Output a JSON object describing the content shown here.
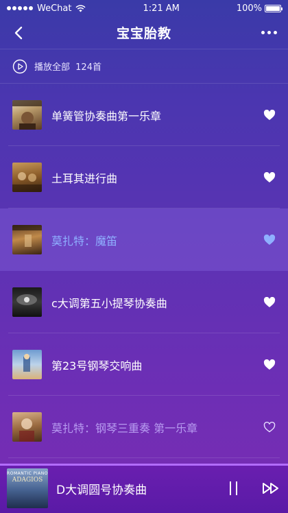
{
  "status_bar": {
    "carrier": "WeChat",
    "time": "1:21 AM",
    "battery": "100%",
    "battery_level": 1.0
  },
  "nav": {
    "title": "宝宝胎教",
    "back_icon": "back-chevron-icon",
    "more_icon": "more-dots-icon"
  },
  "play_all": {
    "label": "播放全部",
    "count": "124首",
    "icon": "play-circle-icon"
  },
  "songs": [
    {
      "title": "单簧管协奏曲第一乐章",
      "liked": true,
      "state": "normal"
    },
    {
      "title": "土耳其进行曲",
      "liked": true,
      "state": "normal"
    },
    {
      "title": "莫扎特：魔笛",
      "liked": true,
      "state": "active"
    },
    {
      "title": "c大调第五小提琴协奏曲",
      "liked": true,
      "state": "normal"
    },
    {
      "title": "第23号钢琴交响曲",
      "liked": true,
      "state": "normal"
    },
    {
      "title": "莫扎特：钢琴三重奏 第一乐章",
      "liked": false,
      "state": "dim"
    }
  ],
  "player": {
    "title": "D大调圆号协奏曲",
    "cover_line1": "ROMANTIC PIANO",
    "cover_line2": "ADAGIOS",
    "progress": 1.0
  },
  "colors": {
    "active_text": "#8fb0ff",
    "dim_text": "#b79bf0",
    "progress": "#b36cff"
  }
}
